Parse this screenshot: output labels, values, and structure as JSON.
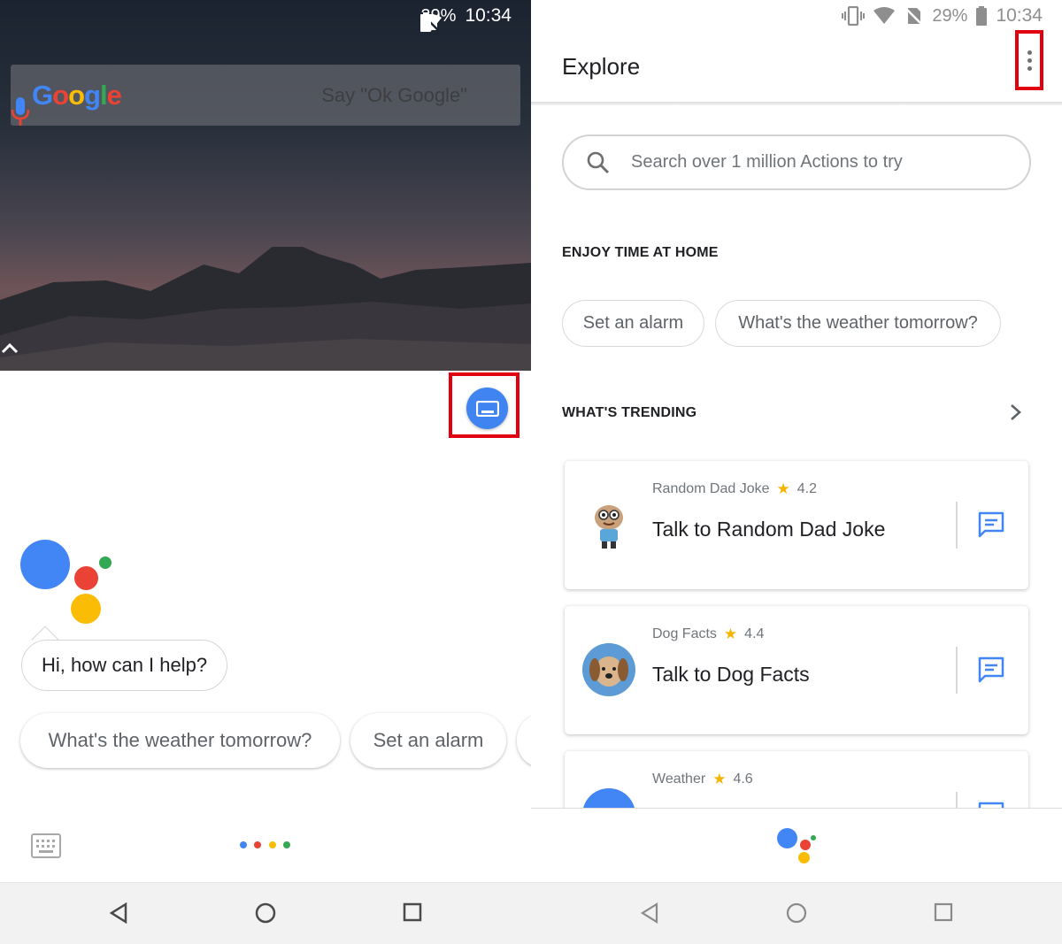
{
  "left": {
    "status": {
      "battery": "29%",
      "time": "10:34"
    },
    "search_widget": {
      "logo": [
        "G",
        "o",
        "o",
        "g",
        "l",
        "e"
      ],
      "hint": "Say \"Ok Google\""
    },
    "assistant": {
      "greeting": "Hi, how can I help?",
      "suggestions": [
        "What's the weather tomorrow?",
        "Set an alarm"
      ]
    }
  },
  "right": {
    "status": {
      "battery": "29%",
      "time": "10:34"
    },
    "title": "Explore",
    "search_placeholder": "Search over 1 million Actions to try",
    "section1": {
      "heading": "ENJOY TIME AT HOME",
      "chips": [
        "Set an alarm",
        "What's the weather tomorrow?"
      ]
    },
    "section2": {
      "heading": "WHAT'S TRENDING",
      "cards": [
        {
          "name": "Random Dad Joke",
          "rating": "4.2",
          "action": "Talk to Random Dad Joke"
        },
        {
          "name": "Dog Facts",
          "rating": "4.4",
          "action": "Talk to Dog Facts"
        },
        {
          "name": "Weather",
          "rating": "4.6",
          "action": ""
        }
      ]
    }
  },
  "colors": {
    "google_blue": "#4285f4",
    "google_red": "#ea4335",
    "google_yellow": "#fbbc05",
    "google_green": "#34a853",
    "highlight": "#e0000f"
  }
}
